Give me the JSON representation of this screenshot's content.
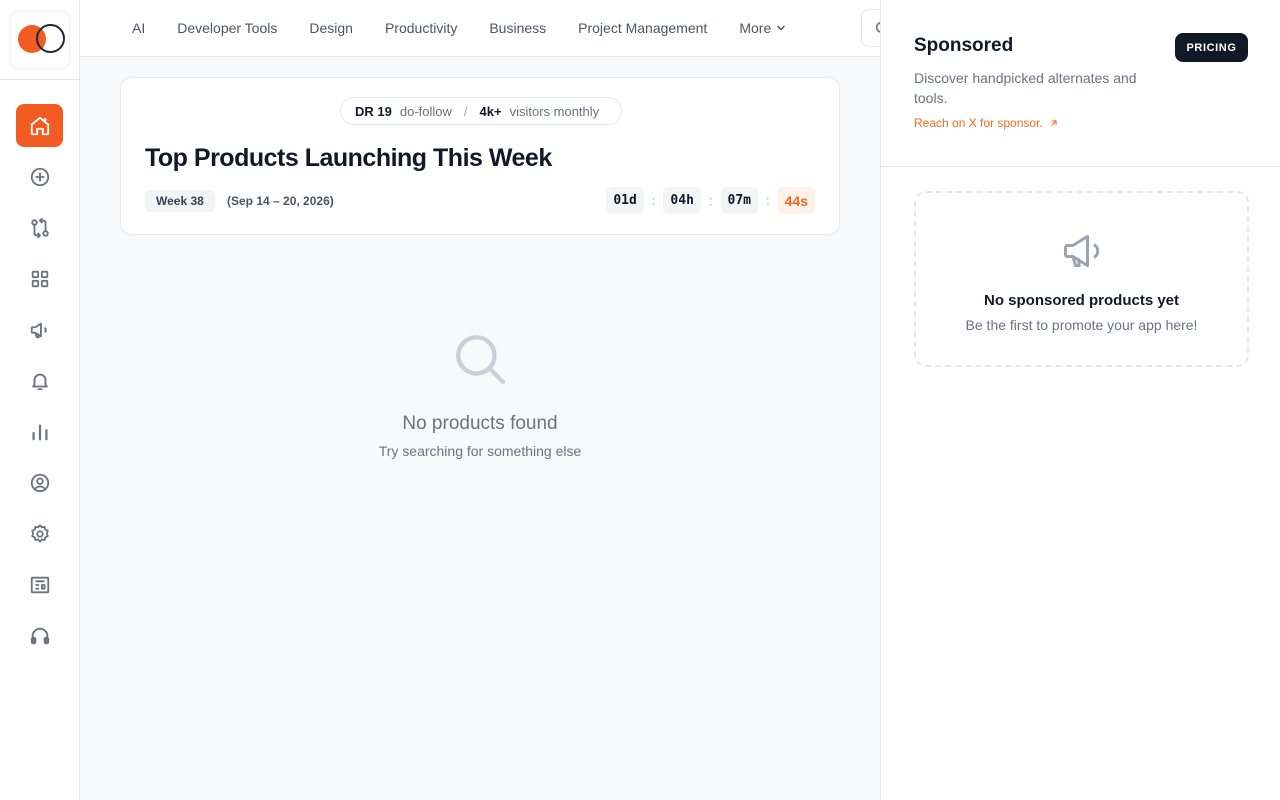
{
  "brand": {
    "accent": "#f25b22",
    "dark": "#111827"
  },
  "sidebar": {
    "items": [
      {
        "icon": "home-icon",
        "active": true
      },
      {
        "icon": "plus-circle-icon"
      },
      {
        "icon": "compare-icon"
      },
      {
        "icon": "grid-icon"
      },
      {
        "icon": "megaphone-icon"
      },
      {
        "icon": "bell-icon"
      },
      {
        "icon": "bar-chart-icon"
      },
      {
        "icon": "user-circle-icon"
      },
      {
        "icon": "gear-icon"
      },
      {
        "icon": "newspaper-icon"
      },
      {
        "icon": "headphones-icon"
      }
    ]
  },
  "topnav": {
    "categories": [
      "AI",
      "Developer Tools",
      "Design",
      "Productivity",
      "Business",
      "Project Management"
    ],
    "more_label": "More"
  },
  "hero": {
    "dr_label": "DR 19",
    "dofollow_label": "do-follow",
    "separator": "/",
    "visitors_value": "4k+",
    "visitors_label": "visitors monthly",
    "title": "Top Products Launching This Week",
    "week_badge": "Week 38",
    "week_range": "(Sep 14 – 20, 2026)",
    "countdown": {
      "days": "01d",
      "hours": "04h",
      "minutes": "07m",
      "seconds": "44s",
      "colon": ":"
    }
  },
  "empty_state": {
    "title": "No products found",
    "subtitle": "Try searching for something else"
  },
  "sponsored": {
    "title": "Sponsored",
    "description": "Discover handpicked alternates and tools.",
    "link_label": "Reach on X for sponsor.",
    "pricing_label": "PRICING",
    "box_title": "No sponsored products yet",
    "box_subtitle": "Be the first to promote your app here!"
  }
}
